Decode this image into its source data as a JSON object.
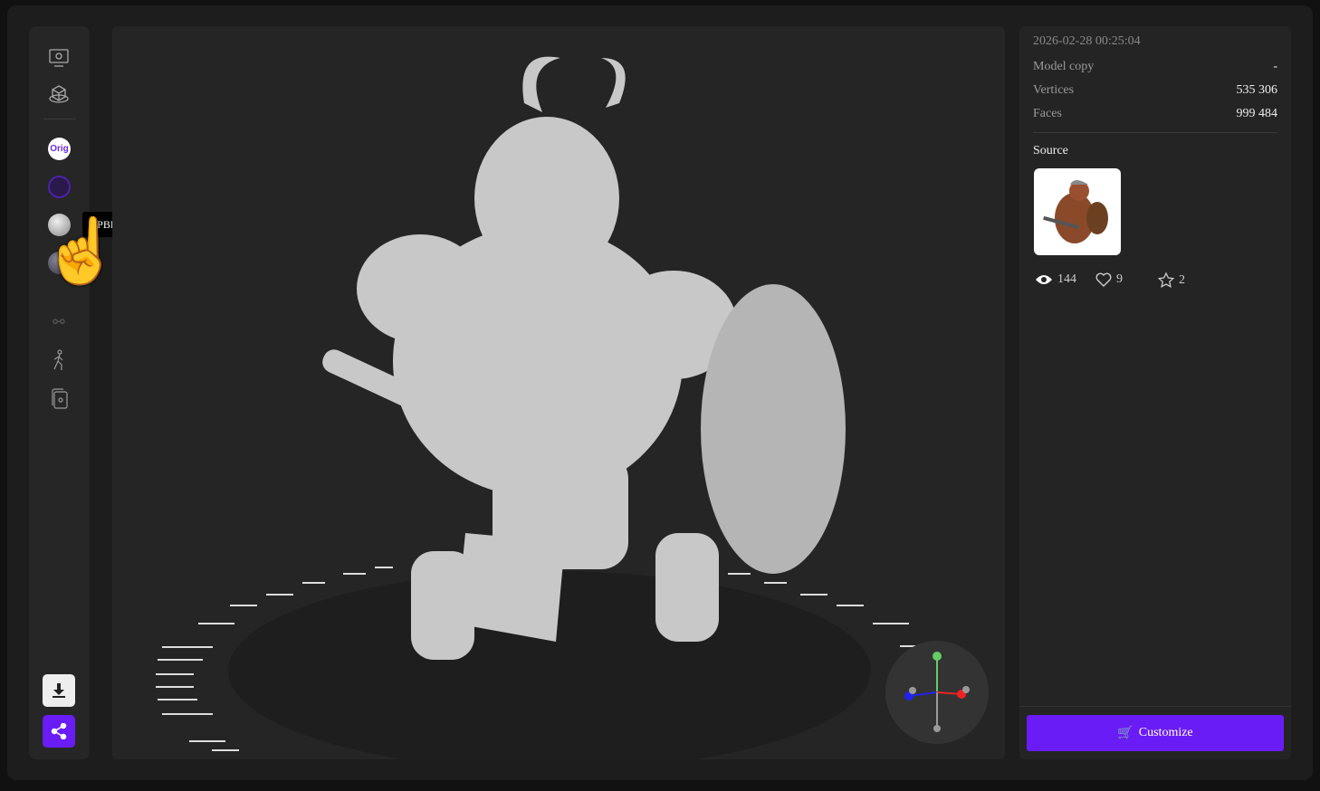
{
  "toolbar": {
    "orig_label": "Orig",
    "tooltip": "PBR"
  },
  "info": {
    "timestamp": "2026-02-28 00:25:04",
    "rows": [
      {
        "label": "Model copy",
        "value": "-"
      },
      {
        "label": "Vertices",
        "value": "535 306"
      },
      {
        "label": "Faces",
        "value": "999 484"
      }
    ],
    "source_label": "Source"
  },
  "stats": {
    "views": "144",
    "likes": "9",
    "stars": "2"
  },
  "actions": {
    "customize": "Customize"
  },
  "colors": {
    "accent": "#6a1cf6"
  }
}
